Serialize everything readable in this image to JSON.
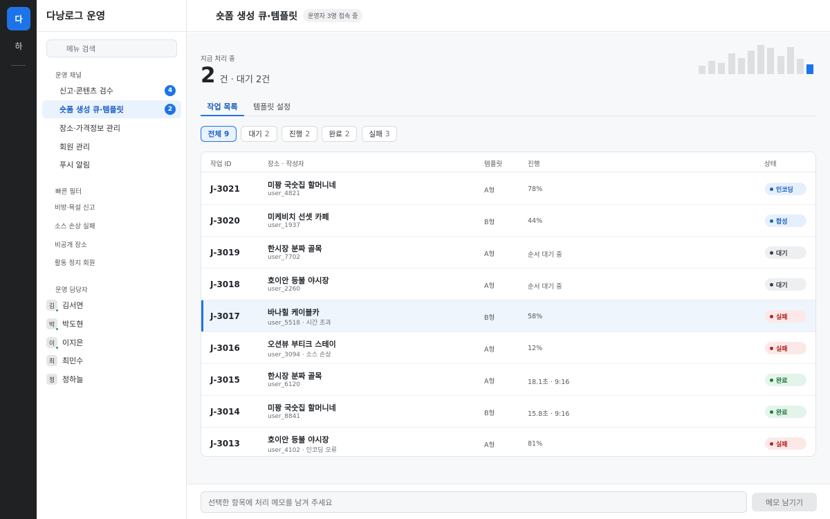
{
  "rail": {
    "items": [
      {
        "label": "다",
        "active": true
      },
      {
        "label": "하",
        "active": false
      }
    ]
  },
  "sidebar": {
    "title": "다낭로그 운영",
    "search_placeholder": "메뉴 검색",
    "channels": {
      "title": "운영 채널",
      "items": [
        {
          "label": "신고·콘텐츠 검수",
          "badge": "4"
        },
        {
          "label": "숏폼 생성 큐·템플릿",
          "badge": "2",
          "active": true
        },
        {
          "label": "장소·가격정보 관리"
        },
        {
          "label": "회원 관리"
        },
        {
          "label": "푸시 알림"
        }
      ]
    },
    "quick_filters": {
      "title": "빠른 필터",
      "items": [
        "비방·욕설 신고",
        "소스 손상 실패",
        "비공개 장소",
        "활동 정지 회원"
      ]
    },
    "staff": {
      "title": "운영 담당자",
      "members": [
        {
          "initial": "김",
          "name": "김서연"
        },
        {
          "initial": "박",
          "name": "박도현"
        },
        {
          "initial": "이",
          "name": "이지은"
        },
        {
          "initial": "최",
          "name": "최민수"
        },
        {
          "initial": "정",
          "name": "정하늘"
        }
      ]
    }
  },
  "topbar": {
    "title": "숏폼 생성 큐·템플릿",
    "presence": "운영자 3명 접속 중"
  },
  "summary": {
    "kicker": "지금 처리 중",
    "count": "2",
    "detail": "건 · 대기 2건",
    "sparkline": [
      0.28,
      0.45,
      0.38,
      0.72,
      0.55,
      0.82,
      1.0,
      0.9,
      0.62,
      0.92,
      0.52,
      0.34
    ]
  },
  "tabs": [
    "작업 목록",
    "템플릿 설정"
  ],
  "filters": [
    {
      "label": "전체",
      "count": "9",
      "active": true
    },
    {
      "label": "대기",
      "count": "2"
    },
    {
      "label": "진행",
      "count": "2"
    },
    {
      "label": "완료",
      "count": "2"
    },
    {
      "label": "실패",
      "count": "3"
    }
  ],
  "table": {
    "headers": {
      "id": "작업 ID",
      "place": "장소 · 작성자",
      "template": "템플릿",
      "progress": "진행",
      "status": "상태"
    },
    "rows": [
      {
        "id": "J-3021",
        "place": "미꽝 국숫집 할머니네",
        "user": "user_4821",
        "template": "A형",
        "progress": "78%",
        "status": "인코딩",
        "kind": "encoding"
      },
      {
        "id": "J-3020",
        "place": "미케비치 선셋 카페",
        "user": "user_1937",
        "template": "B형",
        "progress": "44%",
        "status": "합성",
        "kind": "compose"
      },
      {
        "id": "J-3019",
        "place": "한시장 분짜 골목",
        "user": "user_7702",
        "template": "A형",
        "progress": "순서 대기 중",
        "status": "대기",
        "kind": "wait"
      },
      {
        "id": "J-3018",
        "place": "호이안 등불 야시장",
        "user": "user_2260",
        "template": "A형",
        "progress": "순서 대기 중",
        "status": "대기",
        "kind": "wait"
      },
      {
        "id": "J-3017",
        "place": "바나힐 케이블카",
        "user": "user_5518 · 시간 초과",
        "template": "B형",
        "progress": "58%",
        "status": "실패",
        "kind": "fail",
        "selected": true
      },
      {
        "id": "J-3016",
        "place": "오션뷰 부티크 스테이",
        "user": "user_3094 · 소스 손상",
        "template": "A형",
        "progress": "12%",
        "status": "실패",
        "kind": "fail"
      },
      {
        "id": "J-3015",
        "place": "한시장 분짜 골목",
        "user": "user_6120",
        "template": "A형",
        "progress": "18.1초 · 9:16",
        "status": "완료",
        "kind": "done"
      },
      {
        "id": "J-3014",
        "place": "미꽝 국숫집 할머니네",
        "user": "user_8841",
        "template": "B형",
        "progress": "15.8초 · 9:16",
        "status": "완료",
        "kind": "done"
      },
      {
        "id": "J-3013",
        "place": "호이안 등불 야시장",
        "user": "user_4102 · 인코딩 오류",
        "template": "A형",
        "progress": "81%",
        "status": "실패",
        "kind": "fail"
      }
    ]
  },
  "footer": {
    "memo_placeholder": "선택한 항목에 처리 메모를 남겨 주세요",
    "memo_button": "메모 남기기"
  }
}
